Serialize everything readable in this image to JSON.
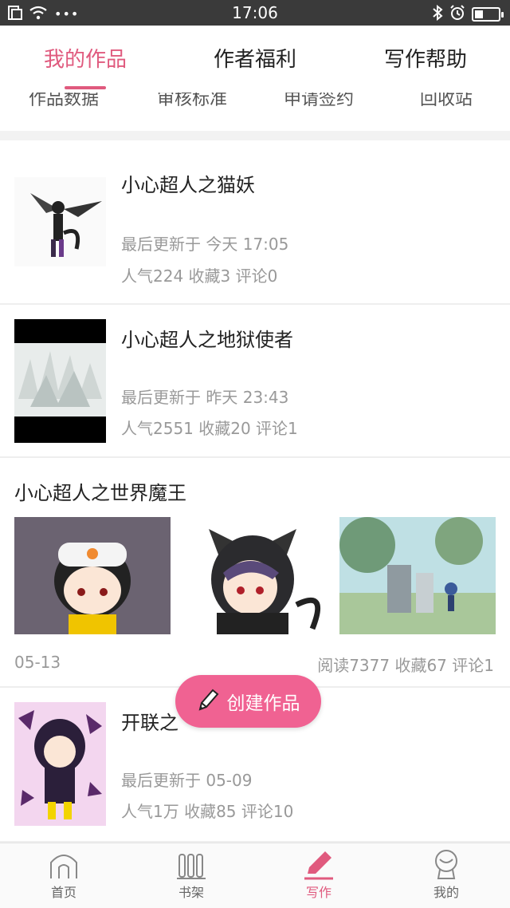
{
  "status_bar": {
    "time": "17:06",
    "dots": "•••",
    "battery_level": 0.35
  },
  "tabs": [
    {
      "label": "我的作品",
      "active": true
    },
    {
      "label": "作者福利",
      "active": false
    },
    {
      "label": "写作帮助",
      "active": false
    }
  ],
  "subtabs": [
    "作品数据",
    "审核标准",
    "申请签约",
    "回收站"
  ],
  "works": [
    {
      "title": "小心超人之猫妖",
      "updated": "最后更新于 今天 17:05",
      "stats": "人气224  收藏3  评论0"
    },
    {
      "title": "小心超人之地狱使者",
      "updated": "最后更新于 昨天 23:43",
      "stats": "人气2551  收藏20  评论1"
    },
    {
      "title": "小心超人之世界魔王",
      "date": "05-13",
      "stats": "阅读7377  收藏67  评论1"
    },
    {
      "title": "开联之",
      "updated": "最后更新于 05-09",
      "stats": "人气1万  收藏85  评论10"
    }
  ],
  "fab": {
    "label": "创建作品"
  },
  "bottom_nav": [
    {
      "label": "首页",
      "icon": "home-icon"
    },
    {
      "label": "书架",
      "icon": "bookshelf-icon"
    },
    {
      "label": "写作",
      "icon": "pen-icon",
      "active": true
    },
    {
      "label": "我的",
      "icon": "profile-icon"
    }
  ],
  "colors": {
    "accent": "#e05a7e",
    "fab": "#f06292",
    "status_bar": "#3a3a3a"
  }
}
